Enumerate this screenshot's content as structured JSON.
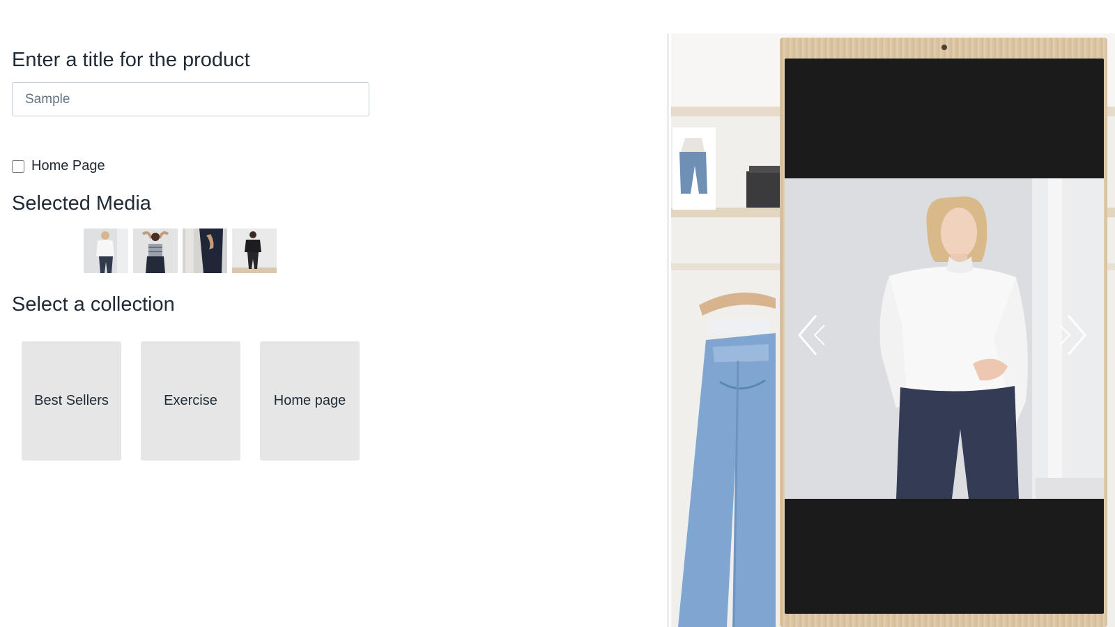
{
  "form": {
    "title_heading": "Enter a title for the product",
    "title_placeholder": "Sample",
    "home_page_checkbox_label": "Home Page",
    "home_page_checked": false,
    "media_heading": "Selected Media",
    "collection_heading": "Select a collection"
  },
  "media_thumbnails": [
    {
      "icon": "model-white-sweater-thumbnail"
    },
    {
      "icon": "model-striped-top-thumbnail"
    },
    {
      "icon": "model-dark-outfit-thumbnail"
    },
    {
      "icon": "model-black-outfit-thumbnail"
    }
  ],
  "collections": [
    {
      "label": "Best Sellers"
    },
    {
      "label": "Exercise"
    },
    {
      "label": "Home page"
    }
  ],
  "preview": {
    "prev_icon": "chevron-left-icon",
    "next_icon": "chevron-right-icon"
  },
  "colors": {
    "text": "#212b36",
    "card_bg": "#e6e6e6",
    "screen_bg": "#1b1b1b",
    "kiosk_wood": "#dcc6a5"
  }
}
